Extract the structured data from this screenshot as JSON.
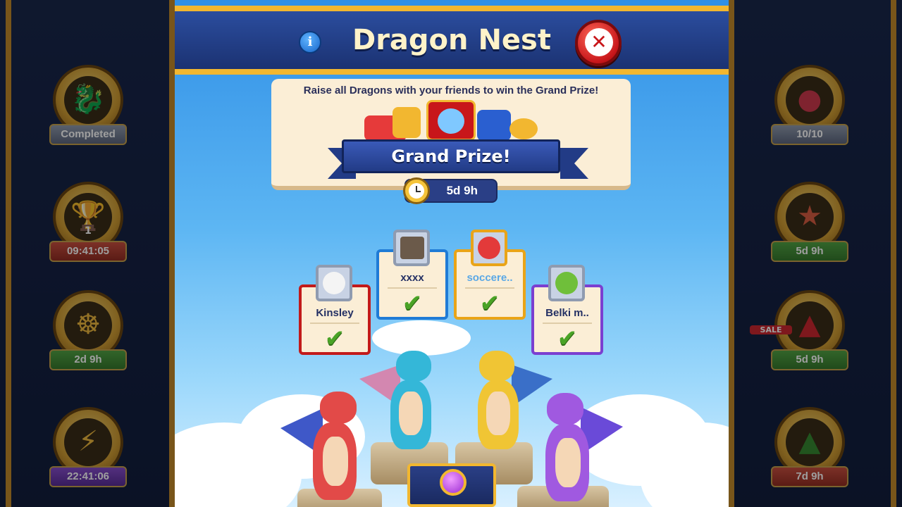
{
  "modal": {
    "title": "Dragon Nest",
    "info_icon": "info-icon",
    "close_icon": "close-icon",
    "description": "Raise all Dragons with your friends to win the Grand Prize!",
    "grand_prize_label": "Grand Prize!",
    "timer": "5d 9h"
  },
  "players": [
    {
      "name": "Kinsley",
      "color": "#c21a1a",
      "status_icon": "check-icon"
    },
    {
      "name": "xxxx",
      "color": "#1f7bd6",
      "status_icon": "check-icon"
    },
    {
      "name": "soccere..",
      "color": "#e9a418",
      "status_icon": "check-icon"
    },
    {
      "name": "Belki m..",
      "color": "#7b3fd0",
      "status_icon": "check-icon"
    }
  ],
  "left_events": [
    {
      "label": "Completed",
      "icon": "dragon-icon"
    },
    {
      "label": "09:41:05",
      "badge": "1",
      "icon": "trophy-icon"
    },
    {
      "label": "2d 9h",
      "icon": "ship-wheel-icon"
    },
    {
      "label": "22:41:06",
      "icon": "lightning-icon"
    }
  ],
  "right_events": [
    {
      "label": "10/10",
      "icon": "ornament-ball-icon"
    },
    {
      "label": "5d 9h",
      "icon": "star-key-icon"
    },
    {
      "label": "5d 9h",
      "icon": "santa-hat-icon",
      "tag": "SALE"
    },
    {
      "label": "7d 9h",
      "icon": "christmas-tree-icon"
    }
  ],
  "colors": {
    "header_blue": "#1b3272",
    "gold_border": "#f2b730",
    "close_red": "#c8161a",
    "check_green": "#4aa326"
  }
}
